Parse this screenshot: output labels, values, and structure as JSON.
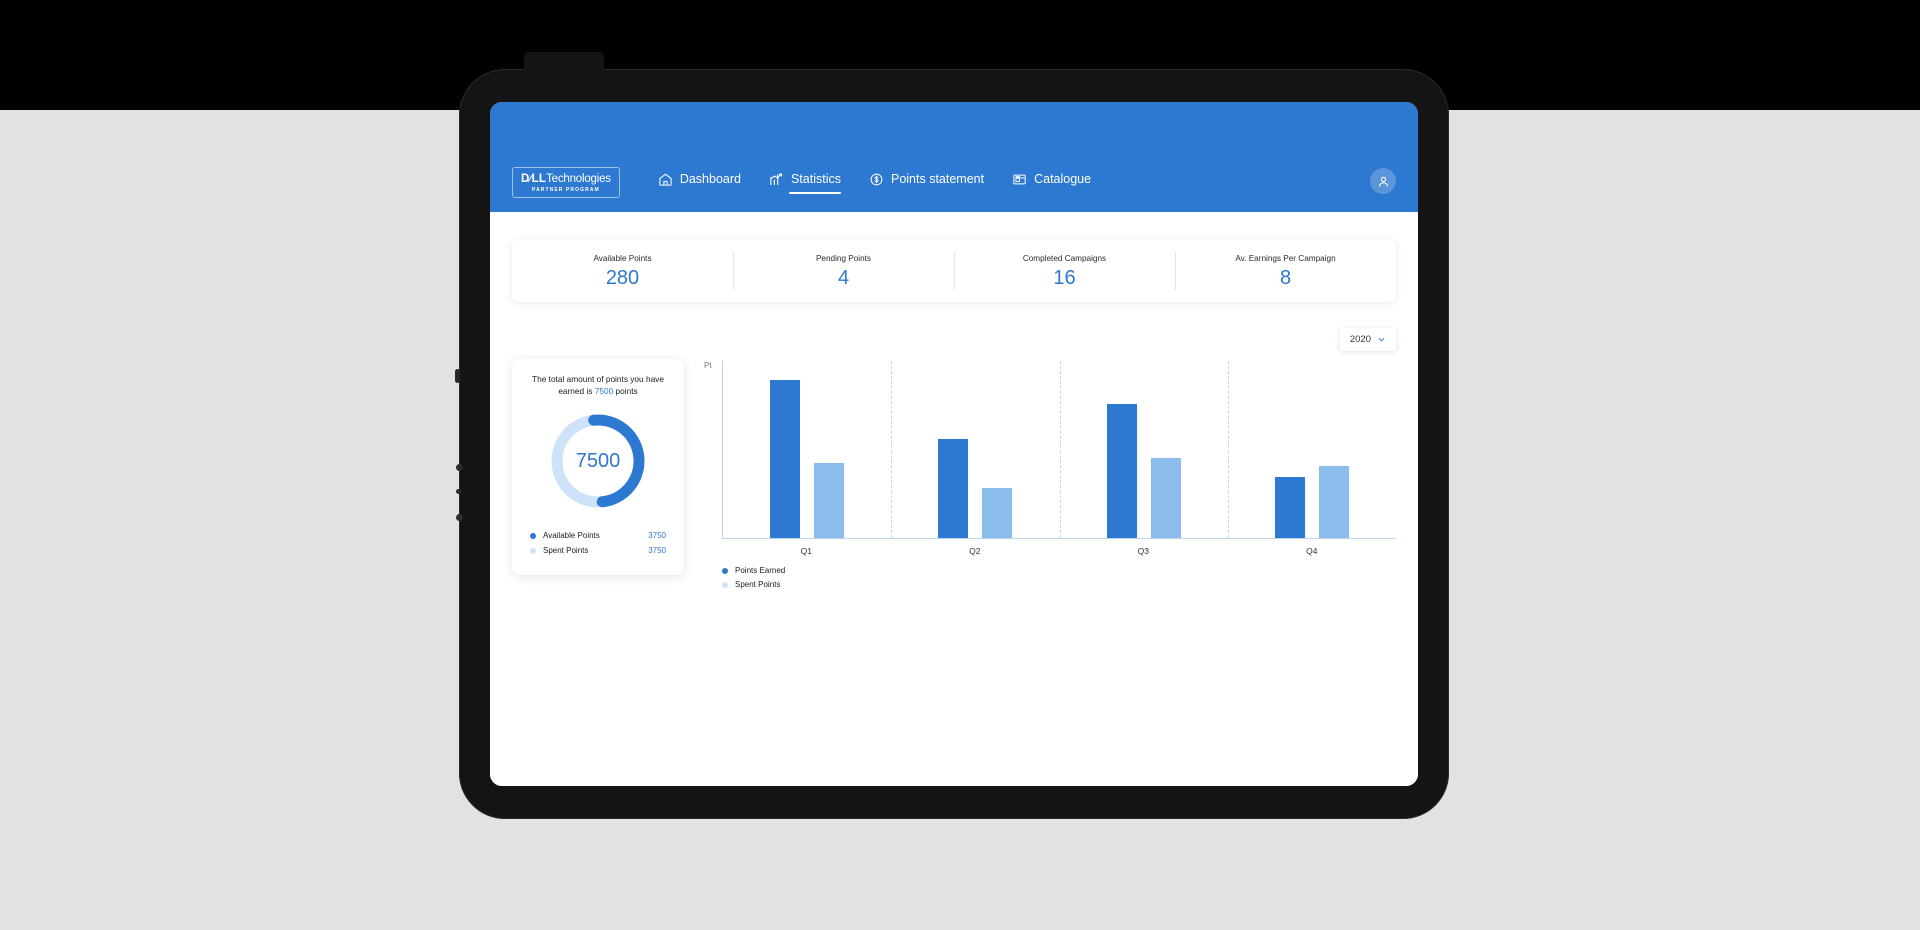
{
  "colors": {
    "header_blue": "#2d78d0",
    "accent_blue": "#2d78d0",
    "light_blue": "#8cbceb",
    "page_bg": "#e2e2e2",
    "frame": "#141416"
  },
  "header": {
    "logo": {
      "dell": "D∕LL",
      "technologies": "Technologies",
      "subtitle": "PARTNER PROGRAM"
    },
    "nav": [
      {
        "label": "Dashboard",
        "icon": "home-icon",
        "active": false
      },
      {
        "label": "Statistics",
        "icon": "bar-chart-icon",
        "active": true
      },
      {
        "label": "Points statement",
        "icon": "dollar-circle-icon",
        "active": false
      },
      {
        "label": "Catalogue",
        "icon": "gift-card-icon",
        "active": false
      }
    ],
    "avatar_icon": "user-icon"
  },
  "kpis": [
    {
      "label": "Available Points",
      "value": "280"
    },
    {
      "label": "Pending Points",
      "value": "4"
    },
    {
      "label": "Completed Campaigns",
      "value": "16"
    },
    {
      "label": "Av. Earnings Per Campaign",
      "value": "8"
    }
  ],
  "year_filter": {
    "value": "2020",
    "chevron_icon": "chevron-down-icon"
  },
  "donut_card": {
    "title_part1": "The total amount of points you have earned is ",
    "title_highlight": "7500",
    "title_part2": " points",
    "center_value": "7500",
    "legend": [
      {
        "label": "Available Points",
        "value": "3750",
        "color": "#2d78d0"
      },
      {
        "label": "Spent Points",
        "value": "3750",
        "color": "#cfe3f8"
      }
    ]
  },
  "chart_data": {
    "type": "bar",
    "title": "",
    "ylabel": "Pt",
    "xlabel": "",
    "categories": [
      "Q1",
      "Q2",
      "Q3",
      "Q4"
    ],
    "series": [
      {
        "name": "Points Earned",
        "color": "#2d78d0",
        "values": [
          159,
          100,
          135,
          61
        ]
      },
      {
        "name": "Spent Points",
        "color": "#8cbceb",
        "values": [
          75,
          50,
          80,
          72
        ]
      }
    ],
    "ylim": [
      0,
      178
    ],
    "grid": "vertical-dashed-separators",
    "legend_position": "bottom-left"
  }
}
